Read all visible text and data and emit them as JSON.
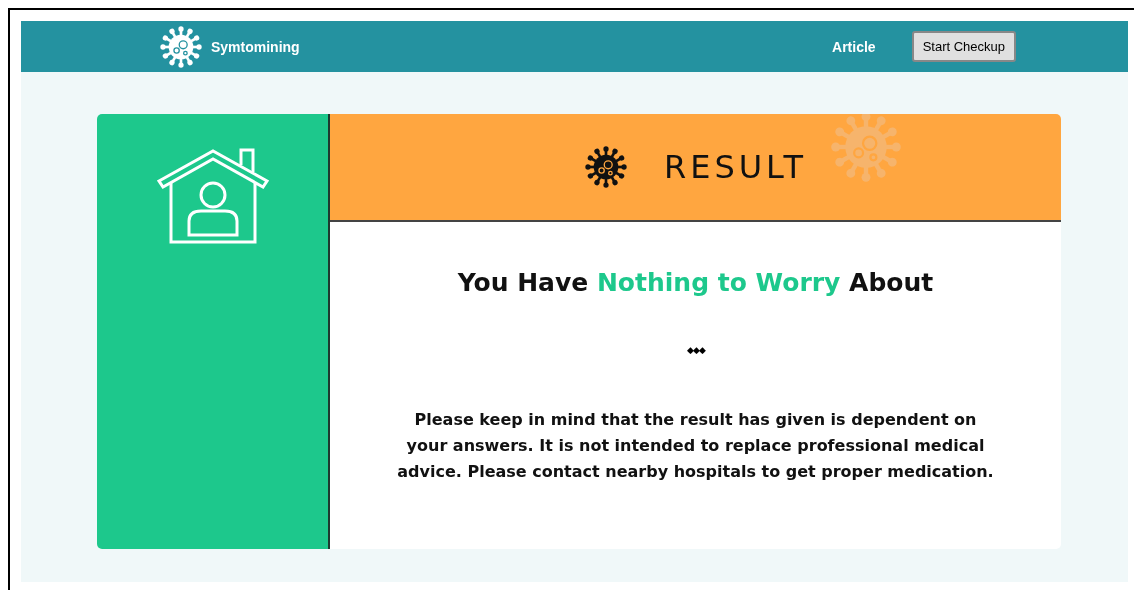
{
  "navbar": {
    "brand": "Symtomining",
    "links": [
      {
        "label": "Article"
      }
    ],
    "button": "Start Checkup"
  },
  "result": {
    "banner_title": "RESULT",
    "headline": [
      {
        "text": "You Have ",
        "highlight": false
      },
      {
        "text": "Nothing to Worry",
        "highlight": true
      },
      {
        "text": " About",
        "highlight": false
      }
    ],
    "divider": "◆◆◆",
    "message": "Please keep in mind that the result has given is dependent on your answers. It is not intended to replace professional medical advice. Please contact nearby hospitals to get proper medication."
  }
}
